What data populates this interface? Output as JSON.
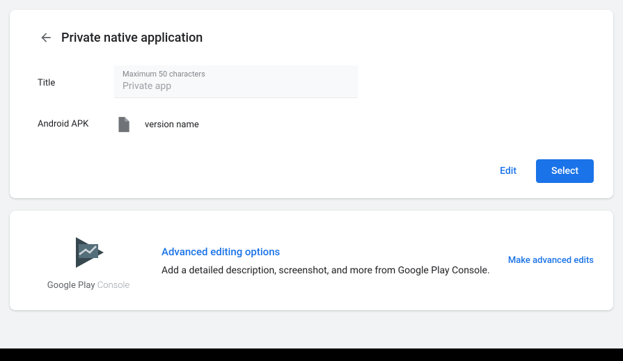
{
  "header": {
    "title": "Private native application"
  },
  "form": {
    "title_label": "Title",
    "title_hint": "Maximum 50 characters",
    "title_placeholder": "Private app",
    "apk_label": "Android APK",
    "apk_version": "version name"
  },
  "actions": {
    "edit": "Edit",
    "select": "Select"
  },
  "advanced": {
    "logo_label_main": "Google Play ",
    "logo_label_accent": "Console",
    "title": "Advanced editing options",
    "description": "Add a detailed description, screenshot, and more from Google Play Console.",
    "link": "Make advanced edits"
  }
}
